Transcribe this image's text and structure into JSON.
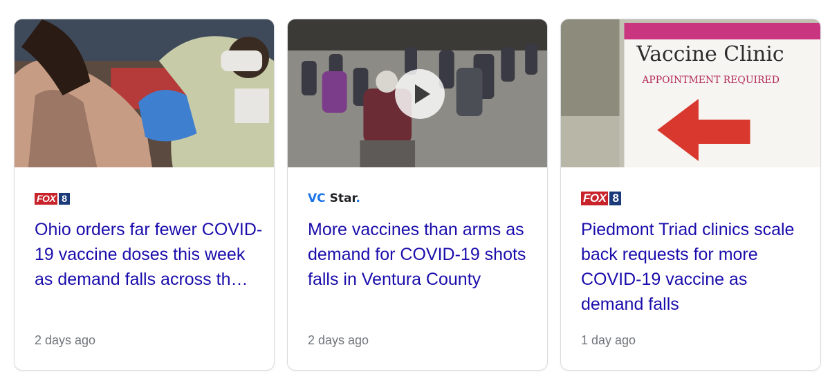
{
  "cards": [
    {
      "source": {
        "logo_main": "FOX",
        "logo_num": "8"
      },
      "headline": "Ohio orders far fewer COVID-19 vaccine doses this week as demand falls across th…",
      "time": "2 days ago",
      "has_video": false
    },
    {
      "source": {
        "logo_main": "VC",
        "logo_rest": "Star",
        "logo_dot": "."
      },
      "headline": "More vaccines than arms as demand for COVID-19 shots falls in Ventura County",
      "time": "2 days ago",
      "has_video": true
    },
    {
      "source": {
        "logo_main": "FOX",
        "logo_num": "8"
      },
      "headline": "Piedmont Triad clinics scale back requests for more COVID-19 vaccine as demand falls",
      "time": "1 day ago",
      "has_video": false,
      "image_sign": {
        "title": "Vaccine Clinic",
        "subtitle": "APPOINTMENT REQUIRED"
      }
    }
  ],
  "colors": {
    "headline": "#1a0dab",
    "meta": "#70757a",
    "fox_red": "#c8232a",
    "fox_blue": "#1b3a7a",
    "vc_blue": "#1a73e8"
  }
}
